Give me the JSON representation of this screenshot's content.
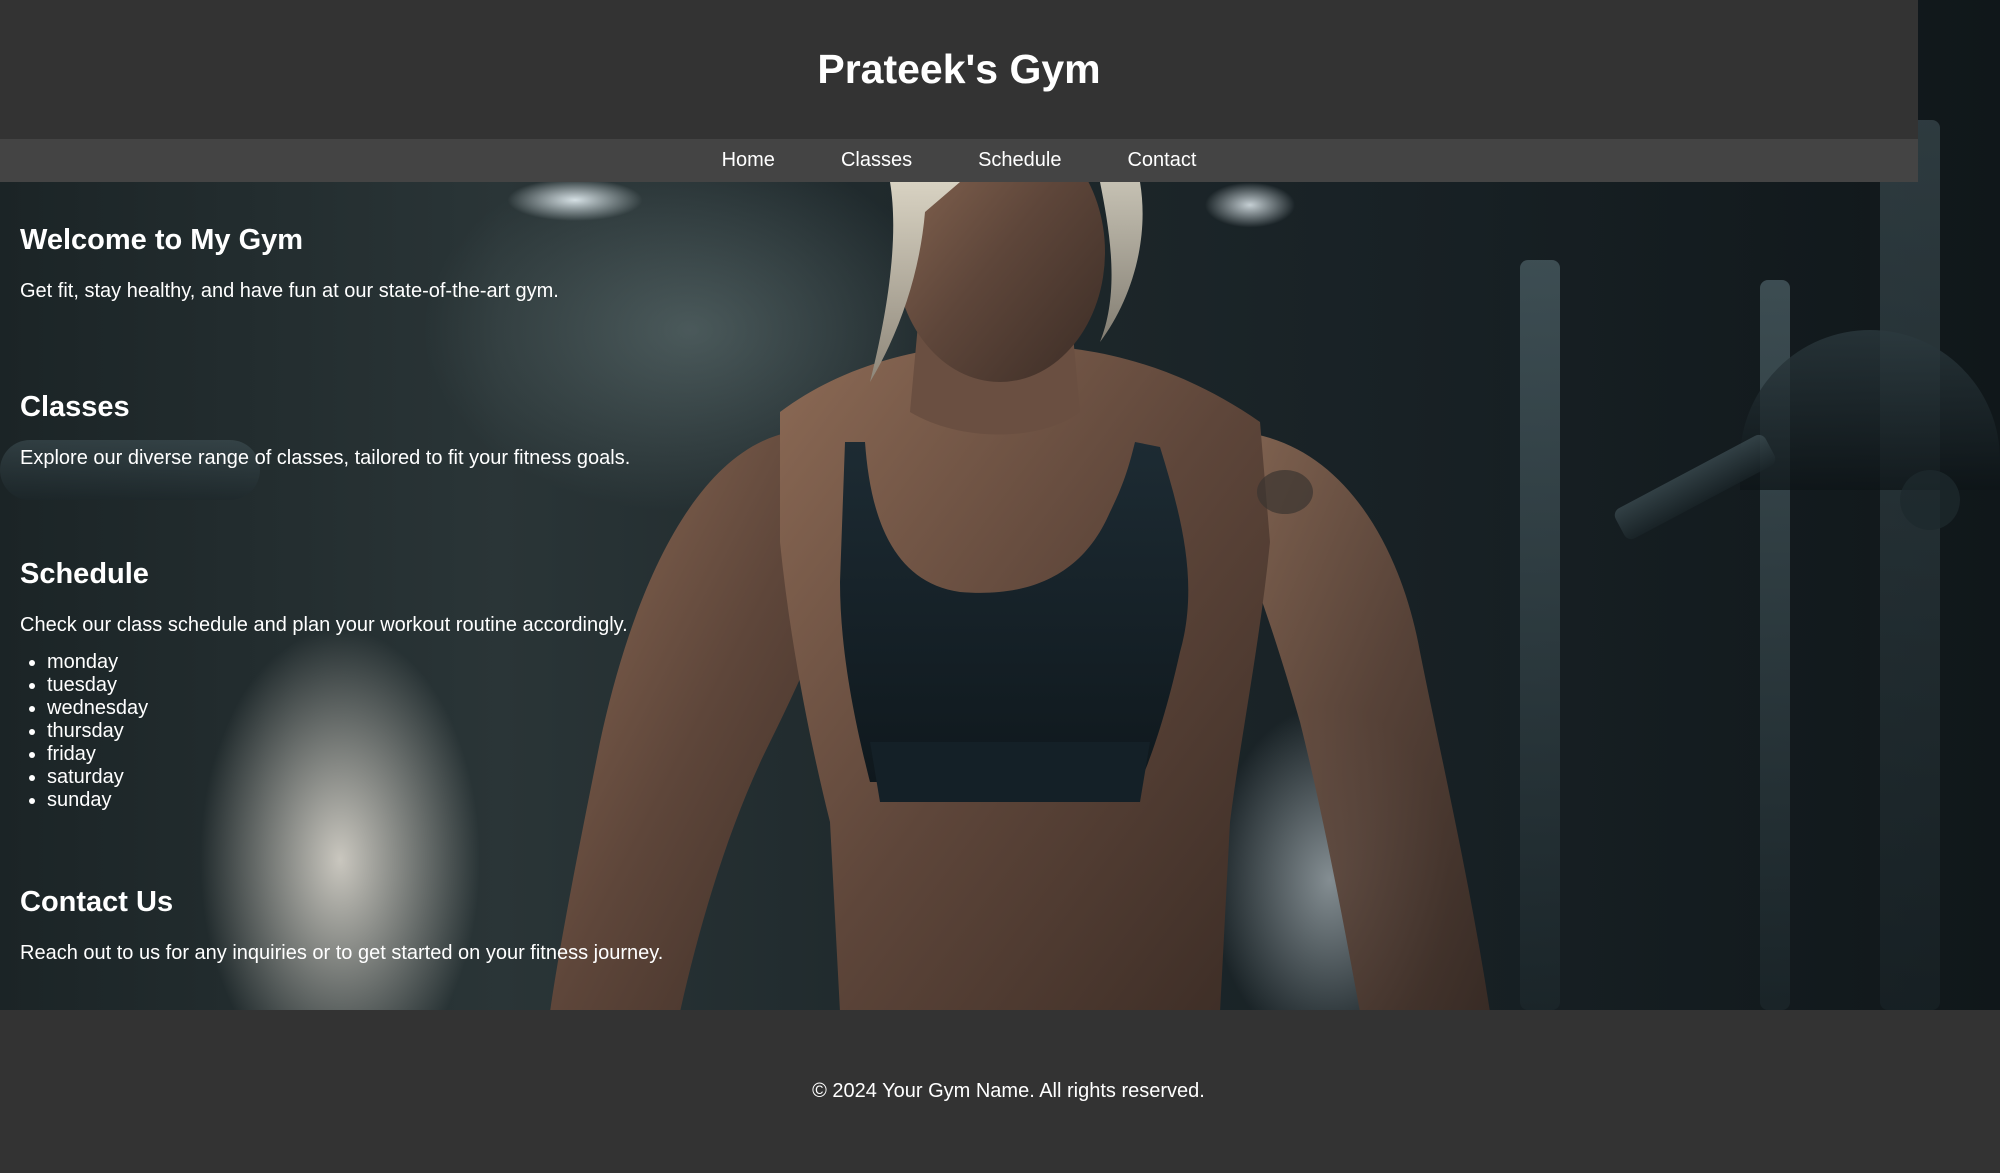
{
  "header": {
    "title": "Prateek's Gym"
  },
  "nav": {
    "items": [
      "Home",
      "Classes",
      "Schedule",
      "Contact"
    ]
  },
  "sections": {
    "welcome": {
      "heading": "Welcome to My Gym",
      "text": "Get fit, stay healthy, and have fun at our state-of-the-art gym."
    },
    "classes": {
      "heading": "Classes",
      "text": "Explore our diverse range of classes, tailored to fit your fitness goals."
    },
    "schedule": {
      "heading": "Schedule",
      "text": "Check our class schedule and plan your workout routine accordingly.",
      "days": [
        "monday",
        "tuesday",
        "wednesday",
        "thursday",
        "friday",
        "saturday",
        "sunday"
      ]
    },
    "contact": {
      "heading": "Contact Us",
      "text": "Reach out to us for any inquiries or to get started on your fitness journey."
    }
  },
  "footer": {
    "text": "© 2024 Your Gym Name. All rights reserved."
  },
  "colors": {
    "header_bg": "#333333",
    "nav_bg": "#444444",
    "text": "#ffffff"
  }
}
